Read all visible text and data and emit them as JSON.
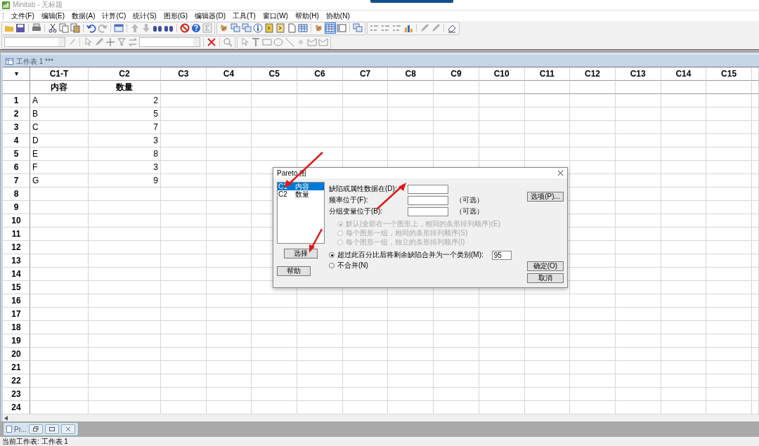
{
  "window": {
    "title": "Minitab - 无标题"
  },
  "menu": [
    "文件(F)",
    "编辑(E)",
    "数据(A)",
    "计算(C)",
    "统计(S)",
    "图形(G)",
    "编辑器(D)",
    "工具(T)",
    "窗口(W)",
    "帮助(H)",
    "协助(N)"
  ],
  "worksheet": {
    "title": "工作表 1 ***",
    "columns": [
      {
        "name": "C1-T",
        "label": "内容",
        "kind": "text"
      },
      {
        "name": "C2",
        "label": "数量",
        "kind": "numeric"
      },
      {
        "name": "C3"
      },
      {
        "name": "C4"
      },
      {
        "name": "C5"
      },
      {
        "name": "C6"
      },
      {
        "name": "C7"
      },
      {
        "name": "C8"
      },
      {
        "name": "C9"
      },
      {
        "name": "C10"
      },
      {
        "name": "C11"
      },
      {
        "name": "C12"
      },
      {
        "name": "C13"
      },
      {
        "name": "C14"
      },
      {
        "name": "C15"
      }
    ],
    "rows": [
      {
        "number": "1",
        "cells": [
          "A",
          "2"
        ]
      },
      {
        "number": "2",
        "cells": [
          "B",
          "5"
        ]
      },
      {
        "number": "3",
        "cells": [
          "C",
          "7"
        ]
      },
      {
        "number": "4",
        "cells": [
          "D",
          "3"
        ]
      },
      {
        "number": "5",
        "cells": [
          "E",
          "8"
        ]
      },
      {
        "number": "6",
        "cells": [
          "F",
          "3"
        ]
      },
      {
        "number": "7",
        "cells": [
          "G",
          "9"
        ]
      },
      {
        "number": "8"
      },
      {
        "number": "9"
      },
      {
        "number": "10"
      },
      {
        "number": "11"
      },
      {
        "number": "12"
      },
      {
        "number": "13"
      },
      {
        "number": "14"
      },
      {
        "number": "15"
      },
      {
        "number": "16"
      },
      {
        "number": "17"
      },
      {
        "number": "18"
      },
      {
        "number": "19"
      },
      {
        "number": "20"
      },
      {
        "number": "21"
      },
      {
        "number": "22"
      },
      {
        "number": "23"
      },
      {
        "number": "24"
      }
    ]
  },
  "dialog": {
    "title": "Pareto 图",
    "variables": [
      {
        "column": "C1",
        "name": "内容",
        "selected": true
      },
      {
        "column": "C2",
        "name": "数量",
        "selected": false
      }
    ],
    "select_button": "选择",
    "help_button": "帮助",
    "fields": [
      {
        "label": "缺陷或属性数据在(D):"
      },
      {
        "label": "频率位于(F):",
        "note": "（可选）"
      },
      {
        "label": "分组变量位于(B):",
        "note": "（可选）"
      }
    ],
    "group_options": [
      {
        "label": "默认(全部在一个图形上，相同的条形排列顺序)(E)",
        "selected": true,
        "disabled": true
      },
      {
        "label": "每个图形一组，相同的条形排列顺序(S)",
        "selected": false,
        "disabled": true
      },
      {
        "label": "每个图形一组，独立的条形排列顺序(I)",
        "selected": false,
        "disabled": true
      }
    ],
    "combine_options": [
      {
        "label": "超过此百分比后将剩余缺陷合并为一个类别(M):",
        "selected": true,
        "value": "95"
      },
      {
        "label": "不合并(N)",
        "selected": false
      }
    ],
    "options_button": "选项(P)...",
    "ok_button": "确定(O)",
    "cancel_button": "取消"
  },
  "minimized_window": {
    "label": "Pr..."
  },
  "status_bar": "当前工作表: 工作表 1"
}
